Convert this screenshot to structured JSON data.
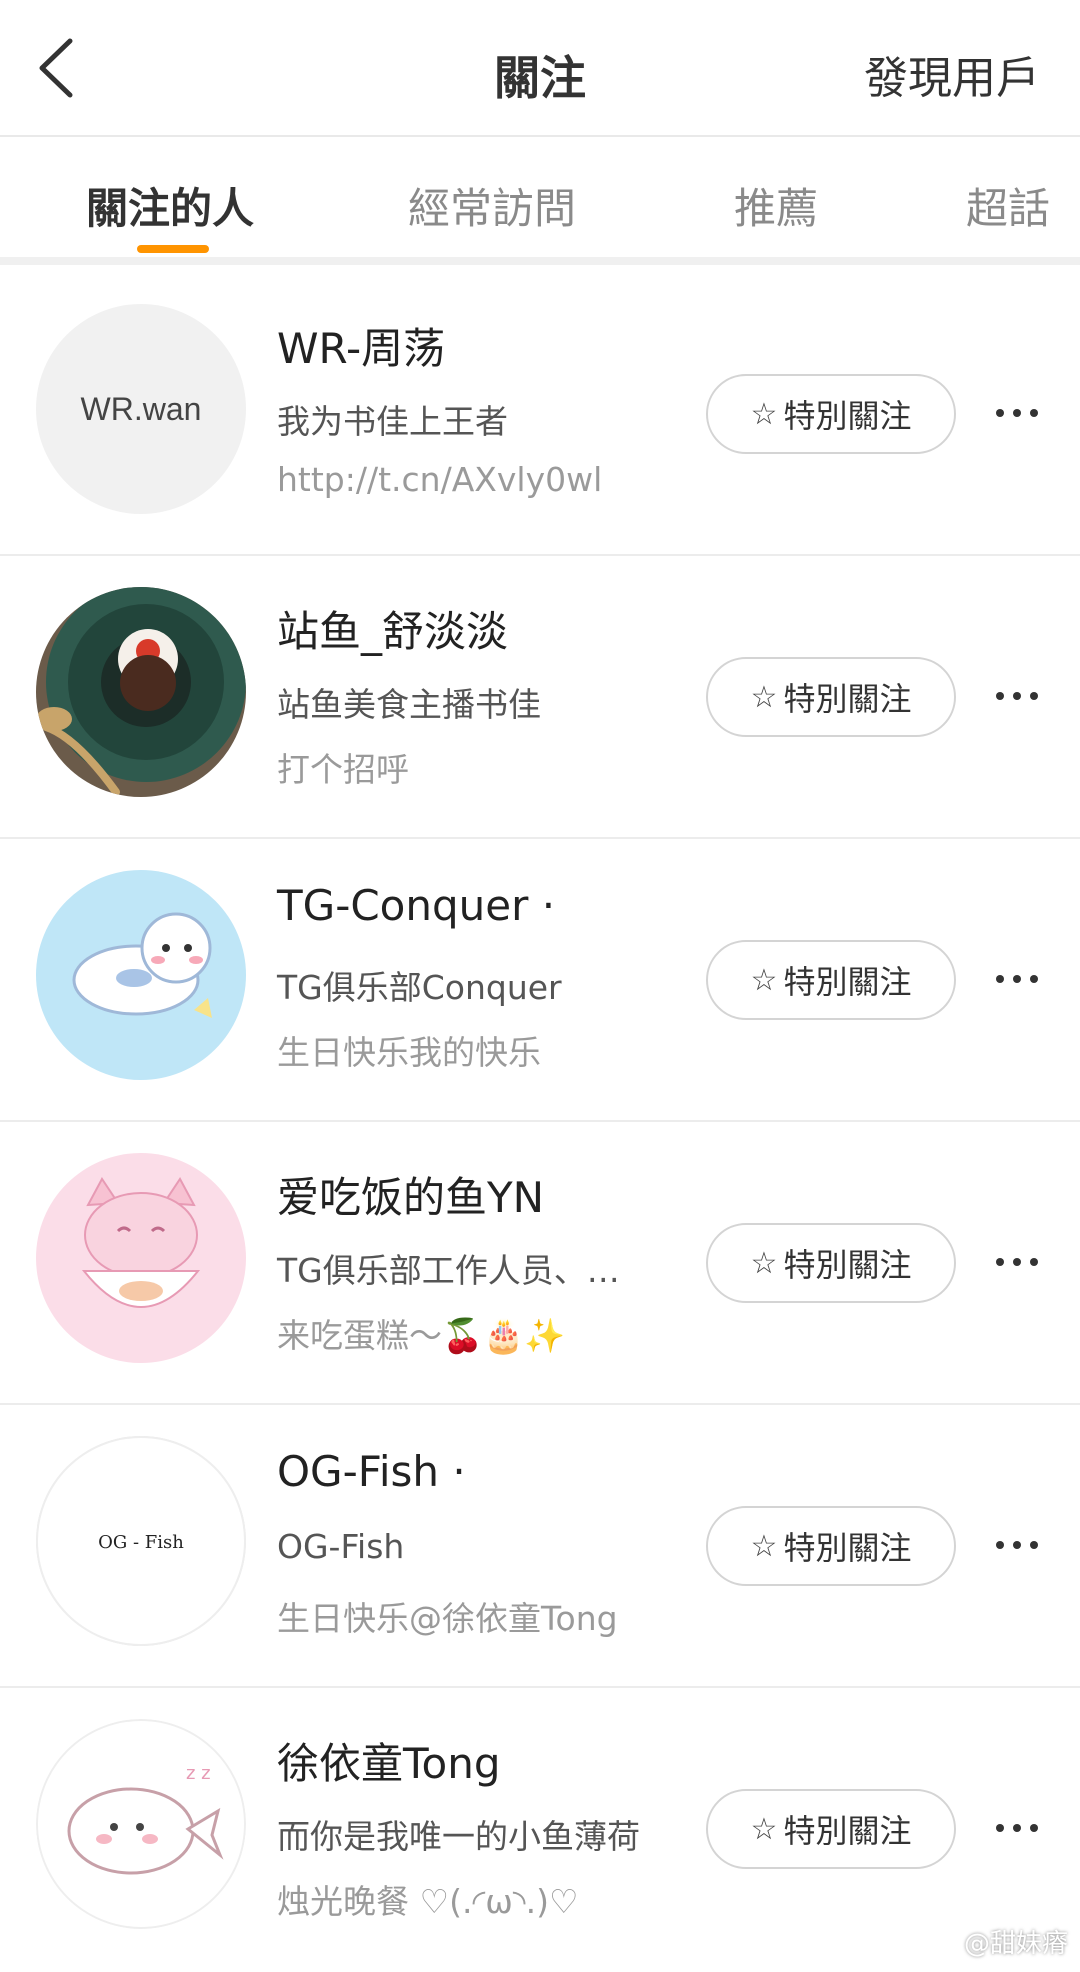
{
  "header": {
    "title": "關注",
    "discover_label": "發現用戶",
    "back_icon": "chevron-left-icon"
  },
  "tabs": [
    {
      "label": "關注的人",
      "active": true
    },
    {
      "label": "經常訪問",
      "active": false
    },
    {
      "label": "推薦",
      "active": false
    },
    {
      "label": "超話",
      "active": false
    }
  ],
  "colors": {
    "accent": "#ff9400",
    "divider": "#ececec"
  },
  "users": [
    {
      "name": "WR-周荡",
      "description": "我为书佳上王者",
      "subtext": "http://t.cn/AXvly0wl",
      "avatar_text": "WR.wan",
      "follow_label": "特別關注"
    },
    {
      "name": "站鱼_舒淡淡",
      "description": "站鱼美食主播书佳",
      "subtext": "打个招呼",
      "avatar_text": "",
      "follow_label": "特別關注"
    },
    {
      "name": "TG-Conquer ·",
      "description": "TG俱乐部Conquer",
      "subtext": "生日快乐我的快乐",
      "avatar_text": "",
      "follow_label": "特別關注"
    },
    {
      "name": "爱吃饭的鱼YN",
      "description": "TG俱乐部工作人员、…",
      "subtext": "来吃蛋糕～🍒🎂✨",
      "avatar_text": "",
      "follow_label": "特別關注"
    },
    {
      "name": "OG-Fish ·",
      "description": "OG-Fish",
      "subtext": "生日快乐@徐依童Tong",
      "avatar_text": "OG - Fish",
      "follow_label": "特別關注"
    },
    {
      "name": "徐依童Tong",
      "description": "而你是我唯一的小鱼薄荷",
      "subtext": "烛光晚餐 ♡(.◜ω◝.)♡",
      "avatar_text": "",
      "follow_label": "特別關注"
    }
  ],
  "watermark": "@甜妹瘠"
}
